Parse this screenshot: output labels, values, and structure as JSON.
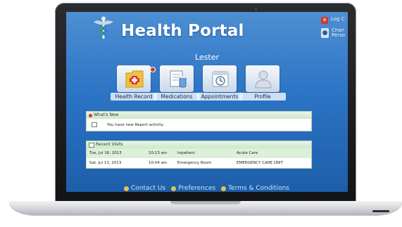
{
  "header": {
    "app_title": "Health Portal",
    "user_name": "Lester",
    "top_links": [
      "Log C",
      "Chan\nPerso"
    ]
  },
  "tiles": [
    "Health Record",
    "Medications",
    "Appointments",
    "Profile"
  ],
  "whats_new": {
    "title": "What's New",
    "message": "You have new Report activity."
  },
  "recent_visits": {
    "title": "Recent Visits",
    "rows": [
      [
        "Tue, Jul 16, 2013",
        "10:13 am",
        "Inpatient",
        "Acute Care"
      ],
      [
        "Sat, Jul 13, 2013",
        "10:04 am",
        "Emergency Room",
        "EMERGENCY CARE UNIT"
      ]
    ]
  },
  "footer": {
    "links": [
      "Contact Us",
      "Preferences",
      "Terms & Conditions"
    ]
  },
  "colors": {
    "screen_blue": "#2c74c5",
    "panel_green": "#dcefd8",
    "alert_red": "#d9322c"
  }
}
